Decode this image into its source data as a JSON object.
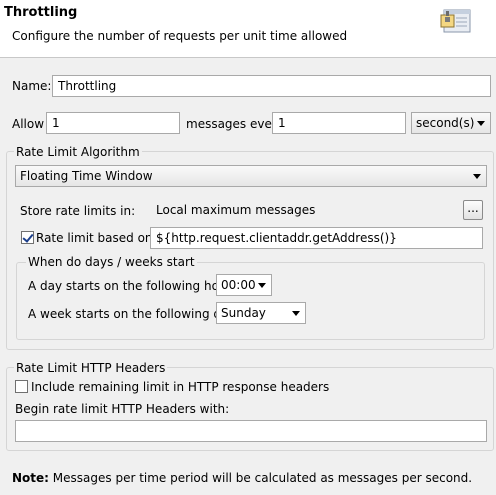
{
  "header": {
    "title": "Throttling",
    "description": "Configure the number of requests per unit time allowed",
    "icon": "throttling-config-icon"
  },
  "name": {
    "label": "Name:",
    "value": "Throttling"
  },
  "allow": {
    "label": "Allow",
    "count": "1",
    "messages_every_label": "messages every",
    "period": "1",
    "unit": "second(s)"
  },
  "algorithm": {
    "group_title": "Rate Limit Algorithm",
    "selected": "Floating Time Window",
    "store_label": "Store rate limits in:",
    "store_value": "Local maximum messages",
    "browse_label": "...",
    "based_on_label": "Rate limit based on:",
    "based_on_checked": true,
    "based_on_value": "${http.request.clientaddr.getAddress()}",
    "days_group_title": "When do days / weeks start",
    "day_start_label": "A day starts on the following hour:",
    "day_start_value": "00:00",
    "week_start_label": "A week starts on the following day:",
    "week_start_value": "Sunday"
  },
  "headers": {
    "group_title": "Rate Limit HTTP Headers",
    "include_label": "Include remaining limit in HTTP response headers",
    "include_checked": false,
    "begin_label": "Begin rate limit HTTP Headers with:",
    "begin_value": ""
  },
  "note": {
    "label": "Note:",
    "text": "Messages per time period will be calculated as messages per second."
  }
}
